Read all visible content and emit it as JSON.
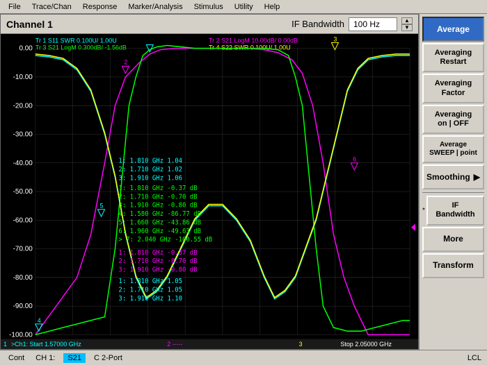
{
  "menubar": {
    "items": [
      "File",
      "Trace/Chan",
      "Response",
      "Marker/Analysis",
      "Stimulus",
      "Utility",
      "Help"
    ]
  },
  "header": {
    "channel": "Channel 1",
    "if_bandwidth_label": "IF Bandwidth",
    "if_bandwidth_value": "100 Hz"
  },
  "traces": [
    {
      "id": "Tr 1",
      "param": "S11",
      "format": "SWR 0.100U/",
      "scale": "1.00U",
      "color": "#00ffff"
    },
    {
      "id": "Tr 2",
      "param": "S21",
      "format": "LogM 10.00dB/",
      "scale": "0.00dB",
      "color": "#ff00ff"
    },
    {
      "id": "Tr 3",
      "param": "S21",
      "format": "LogM 0.300dB/",
      "scale": "-1.56dB",
      "color": "#00ff00"
    },
    {
      "id": "Tr 4",
      "param": "S22",
      "format": "SWR 0.100U/",
      "scale": "1.00U",
      "color": "#ffff00"
    }
  ],
  "right_panel": {
    "buttons": [
      {
        "label": "Average",
        "id": "average",
        "active": true
      },
      {
        "label": "Averaging\nRestart",
        "id": "averaging-restart",
        "active": false
      },
      {
        "label": "Averaging\nFactor",
        "id": "averaging-factor",
        "active": false
      },
      {
        "label": "Averaging on | OFF",
        "id": "averaging-on-off",
        "active": false
      },
      {
        "label": "Average SWEEP | point",
        "id": "average-sweep-point",
        "active": false
      },
      {
        "label": "Smoothing",
        "id": "smoothing",
        "active": false
      },
      {
        "label": "IF\nBandwidth",
        "id": "if-bandwidth",
        "active": false,
        "star": true
      },
      {
        "label": "More",
        "id": "more",
        "active": false
      },
      {
        "label": "Transform",
        "id": "transform",
        "active": false
      }
    ]
  },
  "chart": {
    "y_axis": [
      "0.00",
      "-10.00",
      "-20.00",
      "-30.00",
      "-40.00",
      "-50.00",
      "-60.00",
      "-70.00",
      "-80.00",
      "-90.00",
      "-100.00"
    ],
    "start_freq": "1.57000 GHz",
    "stop_freq": "2.05000 GHz",
    "marker_line": ">Ch1: Start  1.57000 GHz",
    "stop_line": "Stop  2.05000 GHz"
  },
  "status_bar": {
    "cont_label": "Cont",
    "ch1_label": "CH 1:",
    "s21_label": "S21",
    "port_label": "C 2-Port",
    "lcl_label": "LCL"
  }
}
